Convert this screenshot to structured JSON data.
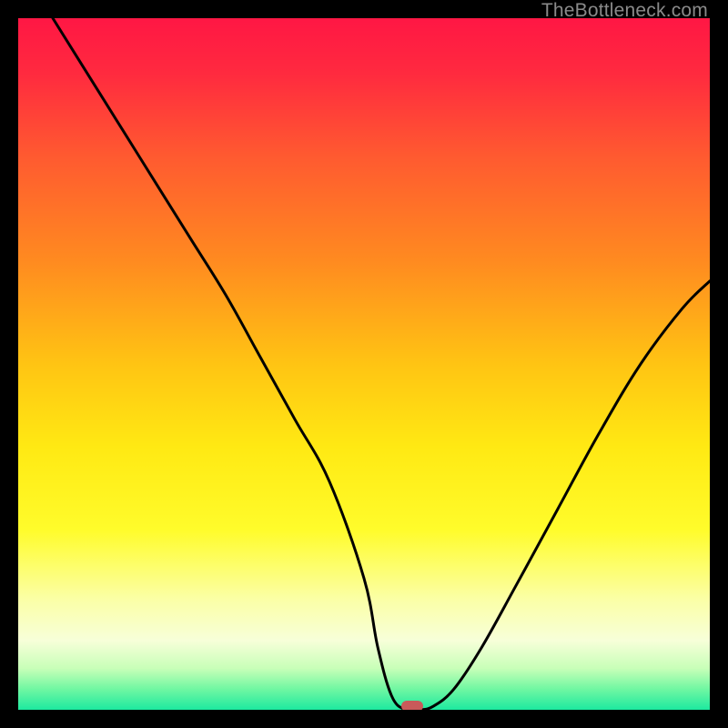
{
  "watermark": "TheBottleneck.com",
  "colors": {
    "frame": "#000000",
    "curve_stroke": "#000000",
    "marker_fill": "#c85a5a",
    "gradient_stops": [
      {
        "offset": 0.0,
        "color": "#ff1744"
      },
      {
        "offset": 0.08,
        "color": "#ff2a3f"
      },
      {
        "offset": 0.2,
        "color": "#ff5a30"
      },
      {
        "offset": 0.35,
        "color": "#ff8a20"
      },
      {
        "offset": 0.5,
        "color": "#ffc413"
      },
      {
        "offset": 0.62,
        "color": "#ffe913"
      },
      {
        "offset": 0.74,
        "color": "#fffc2b"
      },
      {
        "offset": 0.84,
        "color": "#fbffa6"
      },
      {
        "offset": 0.9,
        "color": "#f7ffd9"
      },
      {
        "offset": 0.94,
        "color": "#c8ffb8"
      },
      {
        "offset": 0.97,
        "color": "#70f7a2"
      },
      {
        "offset": 1.0,
        "color": "#1de9a0"
      }
    ]
  },
  "chart_data": {
    "type": "line",
    "title": "",
    "xlabel": "",
    "ylabel": "",
    "xlim": [
      0,
      100
    ],
    "ylim": [
      0,
      100
    ],
    "grid": false,
    "legend": false,
    "series": [
      {
        "name": "bottleneck-curve",
        "x": [
          5,
          10,
          15,
          20,
          25,
          30,
          35,
          40,
          45,
          50,
          52,
          54,
          56,
          58,
          60,
          63,
          67,
          72,
          78,
          84,
          90,
          96,
          100
        ],
        "y": [
          100,
          92,
          84,
          76,
          68,
          60,
          51,
          42,
          33,
          19,
          9,
          2,
          0,
          0,
          0.5,
          3,
          9,
          18,
          29,
          40,
          50,
          58,
          62
        ]
      }
    ],
    "marker": {
      "x": 57,
      "y": 0.5,
      "shape": "pill"
    }
  }
}
